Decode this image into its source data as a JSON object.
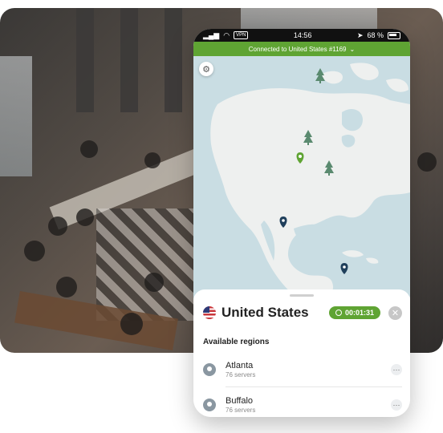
{
  "status_bar": {
    "time": "14:56",
    "vpn": "VPN",
    "battery": "68 %"
  },
  "banner": {
    "text": "Connected to United States #1169",
    "chevron": "⌄"
  },
  "map": {
    "settings_icon": "⚙"
  },
  "sheet": {
    "country": "United States",
    "timer": "00:01:31",
    "close": "✕",
    "regions_title": "Available regions",
    "regions": [
      {
        "name": "Atlanta",
        "servers": "76 servers",
        "more": "···"
      },
      {
        "name": "Buffalo",
        "servers": "76 servers",
        "more": "···"
      }
    ]
  },
  "colors": {
    "accent": "#5fa433",
    "water": "#c9dde3",
    "land": "#eef0ef",
    "pin_dark": "#1f3f5b"
  }
}
